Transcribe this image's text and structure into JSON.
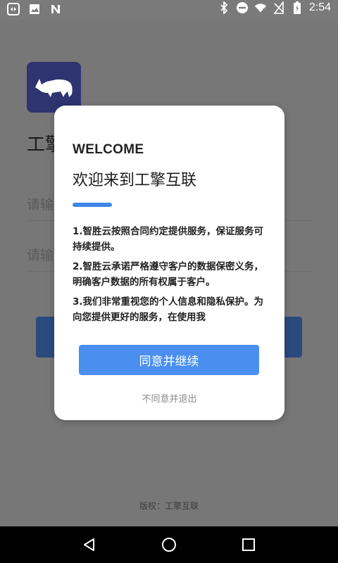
{
  "status_bar": {
    "left_icons": [
      "teamviewer-icon",
      "image-icon",
      "n-app-icon"
    ],
    "right_icons": [
      "bluetooth-icon",
      "do-not-disturb-icon",
      "wifi-icon",
      "no-sim-icon",
      "battery-icon"
    ],
    "time": "2:54"
  },
  "background": {
    "title": "工擎",
    "input_1_placeholder": "请输",
    "input_2_placeholder": "请输",
    "copyright": "版权：工擎互联"
  },
  "dialog": {
    "welcome": "WELCOME",
    "title": "欢迎来到工擎互联",
    "accent_color": "#3f86e6",
    "terms": [
      "1.智胜云按照合同约定提供服务，保证服务可持续提供。",
      "2.智胜云承诺严格遵守客户的数据保密义务，明确客户数据的所有权属于客户。",
      "3.我们非常重视您的个人信息和隐私保护。为向您提供更好的服务，在使用我"
    ],
    "agree_label": "同意并继续",
    "disagree_label": "不同意并退出"
  },
  "nav_bar": {
    "buttons": [
      "back-icon",
      "home-icon",
      "recents-icon"
    ]
  }
}
